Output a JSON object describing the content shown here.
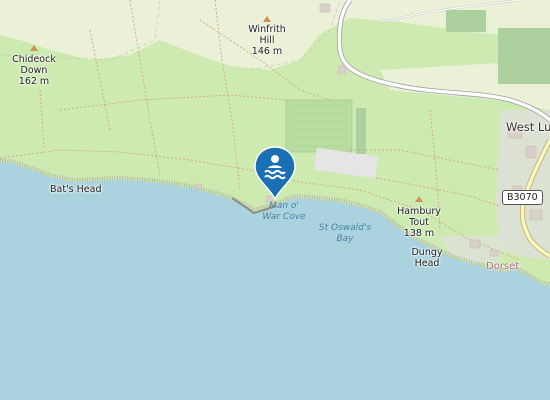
{
  "map": {
    "places": {
      "winfrith_name": "Winfrith",
      "winfrith_sub": "Hill",
      "winfrith_ele": "146 m",
      "chideock_name": "Chideock",
      "chideock_sub": "Down",
      "chideock_ele": "162 m",
      "bats_head": "Bat's Head",
      "west_lulworth": "West Lu",
      "hambury_name": "Hambury",
      "hambury_sub": "Tout",
      "hambury_ele": "138 m",
      "dungy_name": "Dungy",
      "dungy_sub": "Head",
      "dorset": "Dorset"
    },
    "water": {
      "man_o_war_1": "Man o'",
      "man_o_war_2": "War Cove",
      "st_oswalds_1": "St Oswald's",
      "st_oswalds_2": "Bay"
    },
    "road_ref": "B3070",
    "marker_icon": "swimming-icon",
    "colors": {
      "sea": "#aad3df",
      "land": "#e8f0d4",
      "grass": "#cdebb0",
      "marker": "#1a6fb5"
    }
  }
}
